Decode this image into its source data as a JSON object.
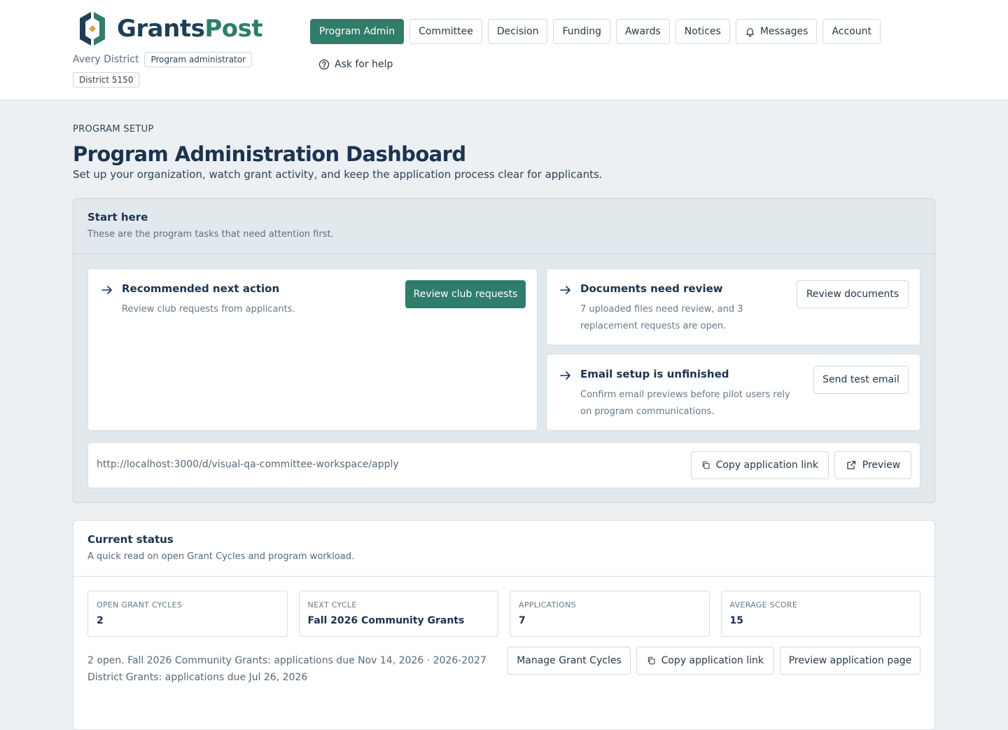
{
  "brand": {
    "part1": "Grants",
    "part2": "Post"
  },
  "org": {
    "name": "Avery District",
    "role": "Program administrator",
    "district": "District 5150"
  },
  "nav": {
    "items": [
      "Program Admin",
      "Committee",
      "Decision",
      "Funding",
      "Awards",
      "Notices",
      "Messages",
      "Account"
    ],
    "active": "Program Admin",
    "help": "Ask for help"
  },
  "page": {
    "eyebrow": "PROGRAM SETUP",
    "title": "Program Administration Dashboard",
    "subtitle": "Set up your organization, watch grant activity, and keep the application process clear for applicants."
  },
  "start_here": {
    "title": "Start here",
    "subtitle": "These are the program tasks that need attention first.",
    "recommended": {
      "title": "Recommended next action",
      "desc": "Review club requests from applicants.",
      "button": "Review club requests"
    },
    "documents": {
      "title": "Documents need review",
      "desc": "7 uploaded files need review, and 3 replacement requests are open.",
      "button": "Review documents"
    },
    "email": {
      "title": "Email setup is unfinished",
      "desc": "Confirm email previews before pilot users rely on program communications.",
      "button": "Send test email"
    },
    "link": {
      "url": "http://localhost:3000/d/visual-qa-committee-workspace/apply",
      "copy": "Copy application link",
      "preview": "Preview"
    }
  },
  "status": {
    "title": "Current status",
    "subtitle": "A quick read on open Grant Cycles and program workload.",
    "stats": [
      {
        "label": "OPEN GRANT CYCLES",
        "value": "2"
      },
      {
        "label": "NEXT CYCLE",
        "value": "Fall 2026 Community Grants"
      },
      {
        "label": "APPLICATIONS",
        "value": "7"
      },
      {
        "label": "AVERAGE SCORE",
        "value": "15"
      }
    ],
    "summary": "2 open. Fall 2026 Community Grants: applications due Nov 14, 2026 · 2026-2027 District Grants: applications due Jul 26, 2026",
    "manage": "Manage Grant Cycles",
    "copy": "Copy application link",
    "preview_page": "Preview application page"
  },
  "colors": {
    "accent": "#2f7d6b",
    "navy": "#1c3350",
    "background": "#ecf0f3"
  },
  "icons": [
    "logo-icon",
    "bell-icon",
    "help-circle-icon",
    "arrow-right-icon",
    "copy-icon",
    "external-link-icon"
  ]
}
